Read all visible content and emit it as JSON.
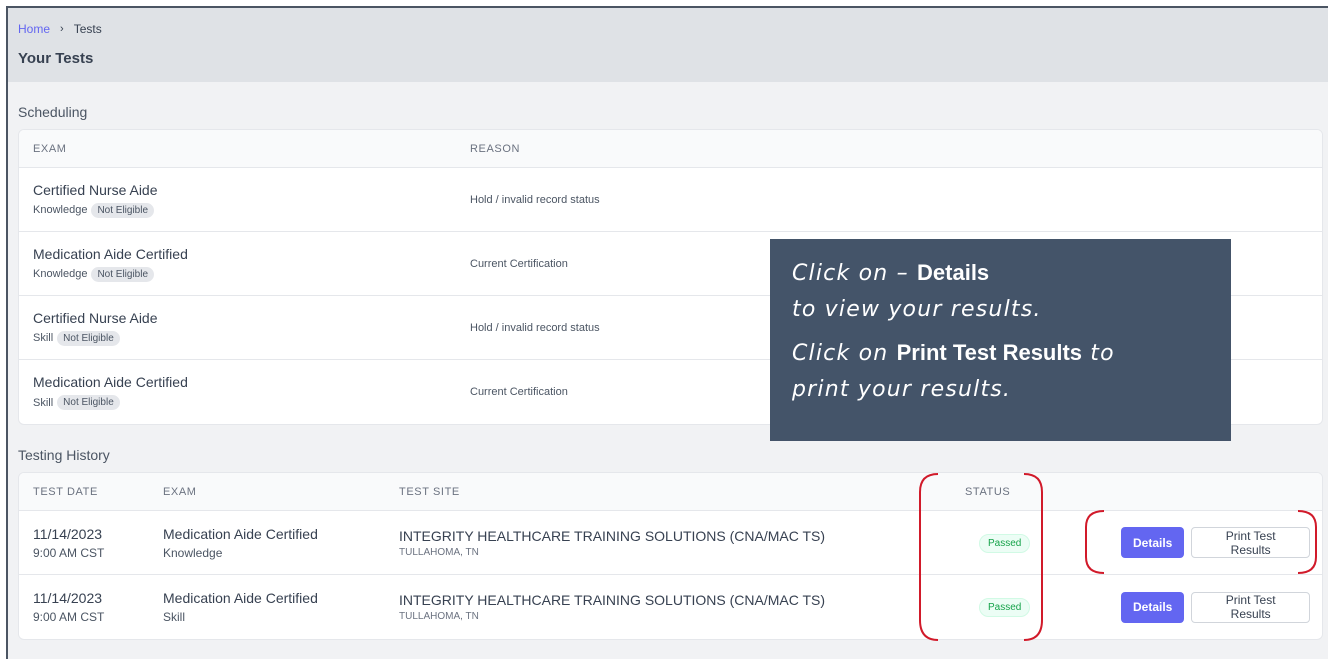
{
  "breadcrumb": {
    "home": "Home",
    "separator": "›",
    "current": "Tests"
  },
  "page_title": "Your Tests",
  "scheduling": {
    "title": "Scheduling",
    "columns": {
      "exam": "EXAM",
      "reason": "REASON"
    },
    "rows": [
      {
        "exam": "Certified Nurse Aide",
        "type": "Knowledge",
        "badge": "Not Eligible",
        "reason": "Hold / invalid record status"
      },
      {
        "exam": "Medication Aide Certified",
        "type": "Knowledge",
        "badge": "Not Eligible",
        "reason": "Current Certification"
      },
      {
        "exam": "Certified Nurse Aide",
        "type": "Skill",
        "badge": "Not Eligible",
        "reason": "Hold / invalid record status"
      },
      {
        "exam": "Medication Aide Certified",
        "type": "Skill",
        "badge": "Not Eligible",
        "reason": "Current Certification"
      }
    ]
  },
  "history": {
    "title": "Testing History",
    "columns": {
      "date": "TEST DATE",
      "exam": "EXAM",
      "site": "TEST SITE",
      "status": "STATUS"
    },
    "rows": [
      {
        "date": "11/14/2023",
        "time": "9:00 AM CST",
        "exam": "Medication Aide Certified",
        "type": "Knowledge",
        "site": "INTEGRITY HEALTHCARE TRAINING SOLUTIONS (CNA/MAC TS)",
        "location": "TULLAHOMA, TN",
        "status": "Passed",
        "details_label": "Details",
        "print_label": "Print Test Results"
      },
      {
        "date": "11/14/2023",
        "time": "9:00 AM CST",
        "exam": "Medication Aide Certified",
        "type": "Skill",
        "site": "INTEGRITY HEALTHCARE TRAINING SOLUTIONS (CNA/MAC TS)",
        "location": "TULLAHOMA, TN",
        "status": "Passed",
        "details_label": "Details",
        "print_label": "Print Test Results"
      }
    ]
  },
  "callout": {
    "line1_italic": "Click on – ",
    "line1_bold": "Details",
    "line2_italic": "to view your results.",
    "line3_italic": "Click on ",
    "line3_bold": "Print Test Results",
    "line3_italic_end": " to",
    "line4_italic": "print your results."
  },
  "colors": {
    "accent": "#6366f1",
    "callout_bg": "#445469",
    "annotation_red": "#d11a2a",
    "passed_green": "#16a34a"
  }
}
